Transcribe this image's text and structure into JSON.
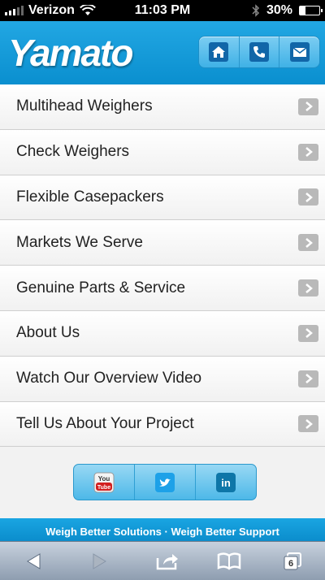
{
  "status_bar": {
    "carrier": "Verizon",
    "time": "11:03 PM",
    "battery": "30%",
    "battery_level": 0.3
  },
  "header": {
    "logo_text": "Yamato",
    "buttons": [
      {
        "icon": "home-icon"
      },
      {
        "icon": "phone-icon"
      },
      {
        "icon": "mail-icon"
      }
    ]
  },
  "menu": {
    "items": [
      {
        "label": "Multihead Weighers"
      },
      {
        "label": "Check Weighers"
      },
      {
        "label": "Flexible Casepackers"
      },
      {
        "label": "Markets We Serve"
      },
      {
        "label": "Genuine Parts & Service"
      },
      {
        "label": "About Us"
      },
      {
        "label": "Watch Our Overview Video"
      },
      {
        "label": "Tell Us About Your Project"
      }
    ]
  },
  "social": {
    "youtube_text": "You Tube",
    "linkedin_text": "in"
  },
  "footer": {
    "tagline": "Weigh Better Solutions · Weigh Better Support"
  },
  "toolbar": {
    "tab_count": "6"
  },
  "colors": {
    "brand_blue": "#0a8fcf",
    "chevron_gray": "#b9b9b9"
  }
}
